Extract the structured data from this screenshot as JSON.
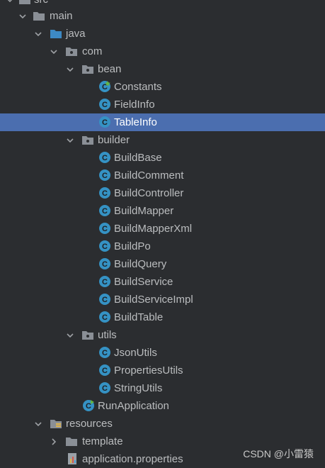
{
  "tree": {
    "src": "src",
    "main": "main",
    "java": "java",
    "com": "com",
    "bean": {
      "folder": "bean",
      "items": [
        "Constants",
        "FieldInfo",
        "TableInfo"
      ]
    },
    "builder": {
      "folder": "builder",
      "items": [
        "BuildBase",
        "BuildComment",
        "BuildController",
        "BuildMapper",
        "BuildMapperXml",
        "BuildPo",
        "BuildQuery",
        "BuildService",
        "BuildServiceImpl",
        "BuildTable"
      ]
    },
    "utils": {
      "folder": "utils",
      "items": [
        "JsonUtils",
        "PropertiesUtils",
        "StringUtils"
      ]
    },
    "run_application": "RunApplication",
    "resources": "resources",
    "template": "template",
    "application_properties": "application.properties"
  },
  "selected_item": "TableInfo",
  "watermark": "CSDN @小雷猿",
  "colors": {
    "background": "#2b2d30",
    "selection": "#4b6eaf",
    "text": "#bbbdbf",
    "class_icon": "#3592c4",
    "folder_blue": "#3d89c4",
    "folder_gray": "#8a8f96"
  }
}
